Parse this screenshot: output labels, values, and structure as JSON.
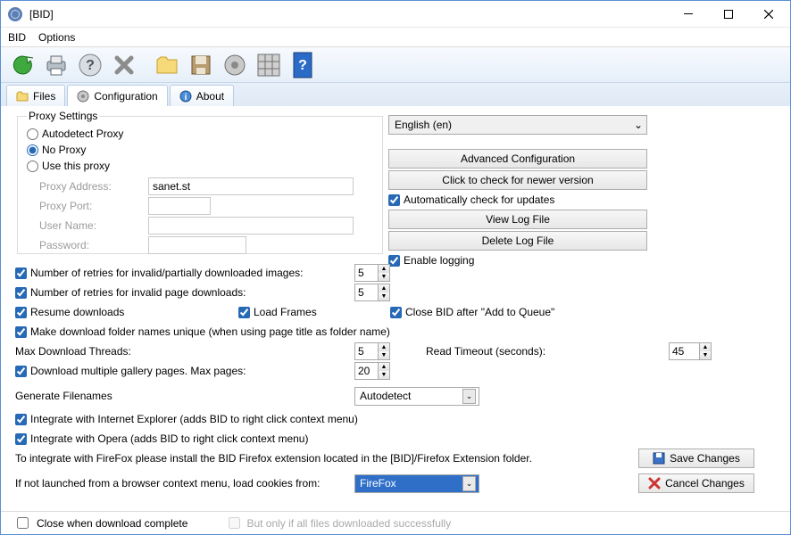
{
  "window": {
    "title": "[BID]"
  },
  "menu": {
    "items": [
      "BID",
      "Options"
    ]
  },
  "toolbar_icons": [
    "refresh",
    "printer",
    "help",
    "close",
    "folder",
    "save",
    "gear",
    "grid",
    "about"
  ],
  "tabs": {
    "files": "Files",
    "config": "Configuration",
    "about": "About"
  },
  "proxy": {
    "legend": "Proxy Settings",
    "autodetect": "Autodetect Proxy",
    "noproxy": "No Proxy",
    "usethis": "Use this proxy",
    "address_label": "Proxy Address:",
    "port_label": "Proxy Port:",
    "user_label": "User Name:",
    "pass_label": "Password:",
    "address_value": "sanet.st"
  },
  "right": {
    "language": "English (en)",
    "adv": "Advanced Configuration",
    "check_update": "Click to check for newer version",
    "auto_update": "Automatically check for updates",
    "view_log": "View Log File",
    "delete_log": "Delete Log File",
    "enable_logging": "Enable logging"
  },
  "opts": {
    "retries_img_label": "Number of retries for invalid/partially downloaded images:",
    "retries_img_val": "5",
    "retries_page_label": "Number of retries for invalid page downloads:",
    "retries_page_val": "5",
    "resume": "Resume downloads",
    "load_frames": "Load Frames",
    "close_after_queue": "Close BID after \"Add to Queue\"",
    "unique_folders": "Make download folder names unique (when using page title as folder name)",
    "max_threads_label": "Max Download Threads:",
    "max_threads_val": "5",
    "read_timeout_label": "Read Timeout (seconds):",
    "read_timeout_val": "45",
    "multi_gallery_label": "Download multiple gallery pages. Max pages:",
    "multi_gallery_val": "20",
    "gen_filenames_label": "Generate Filenames",
    "gen_filenames_val": "Autodetect",
    "integrate_ie": "Integrate with Internet Explorer (adds BID to right click context menu)",
    "integrate_opera": "Integrate with Opera (adds BID to right click context menu)",
    "firefox_note": "To integrate with FireFox please install the BID Firefox extension located in the [BID]/Firefox Extension folder.",
    "cookies_label": "If not launched from a browser context menu, load cookies from:",
    "cookies_val": "FireFox",
    "save": "Save Changes",
    "cancel": "Cancel Changes"
  },
  "status": {
    "close_when_done": "Close when download complete",
    "only_if_success": "But only if all files downloaded successfully"
  }
}
